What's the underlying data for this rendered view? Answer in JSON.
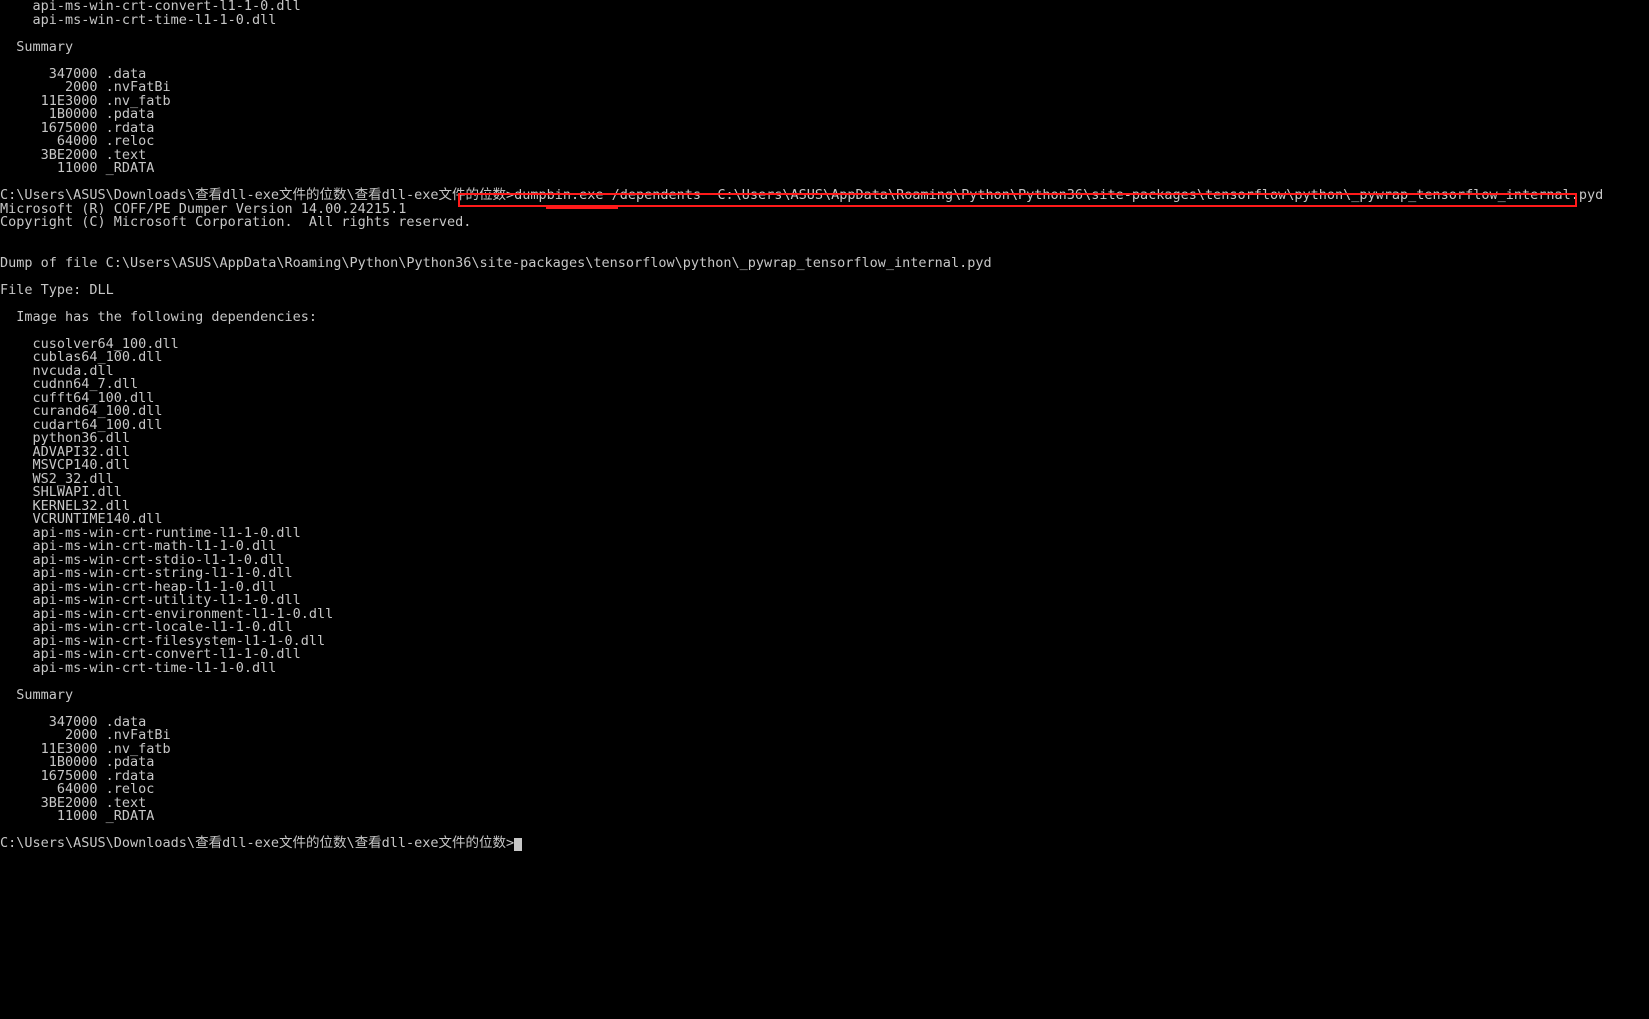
{
  "top_dlls": [
    "api-ms-win-crt-convert-l1-1-0.dll",
    "api-ms-win-crt-time-l1-1-0.dll"
  ],
  "summary1_label": "Summary",
  "summary1": [
    {
      "size": "347000",
      "name": ".data"
    },
    {
      "size": "2000",
      "name": ".nvFatBi"
    },
    {
      "size": "11E3000",
      "name": ".nv_fatb"
    },
    {
      "size": "1B0000",
      "name": ".pdata"
    },
    {
      "size": "1675000",
      "name": ".rdata"
    },
    {
      "size": "64000",
      "name": ".reloc"
    },
    {
      "size": "3BE2000",
      "name": ".text"
    },
    {
      "size": "11000",
      "name": "_RDATA"
    }
  ],
  "prompt1_prefix": "C:\\Users\\ASUS\\Downloads\\查看dll-exe文件的位数\\查看dll-exe文件的位数>",
  "cmd_bin": "dumpbin.exe ",
  "cmd_flag": "/dependents",
  "cmd_arg": "  C:\\Users\\ASUS\\AppData\\Roaming\\Python\\Python36\\site-packages\\tensorflow\\python\\_pywrap_tensorflow_internal.pyd",
  "ms_line1": "Microsoft (R) COFF/PE Dumper Version 14.00.24215.1",
  "ms_line2": "Copyright (C) Microsoft Corporation.  All rights reserved.",
  "dump_of_file": "Dump of file C:\\Users\\ASUS\\AppData\\Roaming\\Python\\Python36\\site-packages\\tensorflow\\python\\_pywrap_tensorflow_internal.pyd",
  "file_type": "File Type: DLL",
  "deps_label": "Image has the following dependencies:",
  "deps": [
    "cusolver64_100.dll",
    "cublas64_100.dll",
    "nvcuda.dll",
    "cudnn64_7.dll",
    "cufft64_100.dll",
    "curand64_100.dll",
    "cudart64_100.dll",
    "python36.dll",
    "ADVAPI32.dll",
    "MSVCP140.dll",
    "WS2_32.dll",
    "SHLWAPI.dll",
    "KERNEL32.dll",
    "VCRUNTIME140.dll",
    "api-ms-win-crt-runtime-l1-1-0.dll",
    "api-ms-win-crt-math-l1-1-0.dll",
    "api-ms-win-crt-stdio-l1-1-0.dll",
    "api-ms-win-crt-string-l1-1-0.dll",
    "api-ms-win-crt-heap-l1-1-0.dll",
    "api-ms-win-crt-utility-l1-1-0.dll",
    "api-ms-win-crt-environment-l1-1-0.dll",
    "api-ms-win-crt-locale-l1-1-0.dll",
    "api-ms-win-crt-filesystem-l1-1-0.dll",
    "api-ms-win-crt-convert-l1-1-0.dll",
    "api-ms-win-crt-time-l1-1-0.dll"
  ],
  "summary2_label": "Summary",
  "summary2": [
    {
      "size": "347000",
      "name": ".data"
    },
    {
      "size": "2000",
      "name": ".nvFatBi"
    },
    {
      "size": "11E3000",
      "name": ".nv_fatb"
    },
    {
      "size": "1B0000",
      "name": ".pdata"
    },
    {
      "size": "1675000",
      "name": ".rdata"
    },
    {
      "size": "64000",
      "name": ".reloc"
    },
    {
      "size": "3BE2000",
      "name": ".text"
    },
    {
      "size": "11000",
      "name": "_RDATA"
    }
  ],
  "prompt2": "C:\\Users\\ASUS\\Downloads\\查看dll-exe文件的位数\\查看dll-exe文件的位数>"
}
